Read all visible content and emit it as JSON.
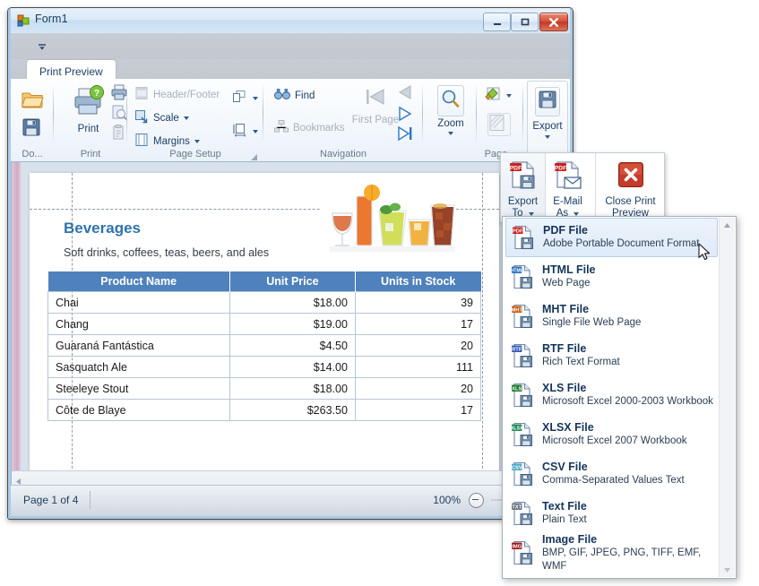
{
  "window": {
    "title": "Form1",
    "icon": "form-icon",
    "buttons": {
      "minimize": "minimize-button",
      "maximize": "maximize-button",
      "close": "close-button"
    }
  },
  "ribbon": {
    "tab": "Print Preview",
    "groups": [
      {
        "name": "Document",
        "label": "Do...",
        "items": [
          {
            "label": "",
            "icon": "open-folder-icon"
          },
          {
            "label": "",
            "icon": "save-floppy-icon"
          }
        ]
      },
      {
        "name": "Print",
        "label": "Print",
        "items": [
          {
            "label": "Print",
            "icon": "printer-icon"
          },
          {
            "label": "",
            "icon": "quick-print-icon"
          },
          {
            "label": "",
            "icon": "print-preview-icon"
          },
          {
            "label": "",
            "icon": "page-setup-icon"
          }
        ]
      },
      {
        "name": "Page Setup",
        "label": "Page Setup",
        "items": [
          {
            "label": "Header/Footer",
            "icon": "header-footer-icon",
            "disabled": true
          },
          {
            "label": "Scale",
            "icon": "scale-icon",
            "dropdown": true
          },
          {
            "label": "Margins",
            "icon": "margins-icon",
            "dropdown": true
          },
          {
            "label": "",
            "icon": "orientation-icon",
            "dropdown": true
          },
          {
            "label": "",
            "icon": "paper-size-icon",
            "dropdown": true
          }
        ]
      },
      {
        "name": "Navigation",
        "label": "Navigation",
        "items": [
          {
            "label": "Find",
            "icon": "binoculars-icon"
          },
          {
            "label": "Bookmarks",
            "icon": "bookmarks-icon",
            "disabled": true
          },
          {
            "label": "First Page",
            "icon": "first-page-icon",
            "disabled": true
          },
          {
            "label": "",
            "icon": "previous-page-icon",
            "disabled": true
          },
          {
            "label": "",
            "icon": "next-page-icon"
          },
          {
            "label": "",
            "icon": "last-page-icon"
          }
        ]
      },
      {
        "name": "Zoom",
        "label": "",
        "items": [
          {
            "label": "Zoom",
            "icon": "magnifier-icon",
            "dropdown": true
          }
        ]
      },
      {
        "name": "Page Background",
        "label": "Page...",
        "items": [
          {
            "label": "",
            "icon": "page-color-icon",
            "dropdown": true
          },
          {
            "label": "",
            "icon": "watermark-icon",
            "disabled": true
          }
        ]
      },
      {
        "name": "Export",
        "label": "",
        "items": [
          {
            "label": "Export",
            "icon": "export-icon",
            "dropdown": true
          }
        ]
      }
    ]
  },
  "report": {
    "title": "Beverages",
    "subtitle": "Soft drinks, coffees, teas, beers, and ales",
    "columns": [
      "Product Name",
      "Unit Price",
      "Units in Stock"
    ],
    "rows": [
      [
        "Chai",
        "$18.00",
        "39"
      ],
      [
        "Chang",
        "$19.00",
        "17"
      ],
      [
        "Guaraná Fantástica",
        "$4.50",
        "20"
      ],
      [
        "Sasquatch Ale",
        "$14.00",
        "111"
      ],
      [
        "Steeleye Stout",
        "$18.00",
        "20"
      ],
      [
        "Côte de Blaye",
        "$263.50",
        "17"
      ]
    ],
    "header_color": "#4f81bd",
    "title_color": "#2f72ad"
  },
  "statusbar": {
    "page_text": "Page 1 of 4",
    "zoom_text": "100%",
    "zoom_out_icon": "zoom-out-icon",
    "zoom_slider": "zoom-slider"
  },
  "floating_toolbar": {
    "items": [
      {
        "label_line1": "Export",
        "label_line2": "To",
        "icon": "export-to-icon",
        "dropdown": true,
        "active": true
      },
      {
        "label_line1": "E-Mail",
        "label_line2": "As",
        "icon": "email-as-icon",
        "dropdown": true
      },
      {
        "label_line1": "Close Print",
        "label_line2": "Preview",
        "icon": "close-preview-icon",
        "dropdown": false
      }
    ]
  },
  "export_menu": {
    "scroll_up_icon": "scroll-up-arrow-icon",
    "scroll_down_icon": "scroll-down-arrow-icon",
    "items": [
      {
        "title": "PDF File",
        "desc": "Adobe Portable Document Format",
        "badge": "PDF",
        "badge_color": "#c9211e",
        "selected": true
      },
      {
        "title": "HTML File",
        "desc": "Web Page",
        "badge": "HTML",
        "badge_color": "#2b6fc4",
        "selected": false
      },
      {
        "title": "MHT File",
        "desc": "Single File Web Page",
        "badge": "MHT",
        "badge_color": "#c75b13",
        "selected": false
      },
      {
        "title": "RTF File",
        "desc": "Rich Text Format",
        "badge": "RTF",
        "badge_color": "#3558b4",
        "selected": false
      },
      {
        "title": "XLS File",
        "desc": "Microsoft Excel 2000-2003 Workbook",
        "badge": "XLS",
        "badge_color": "#1d7a33",
        "selected": false
      },
      {
        "title": "XLSX File",
        "desc": "Microsoft Excel 2007 Workbook",
        "badge": "XLSX",
        "badge_color": "#1d8a56",
        "selected": false
      },
      {
        "title": "CSV File",
        "desc": "Comma-Separated Values Text",
        "badge": "CSV",
        "badge_color": "#4aa8c4",
        "selected": false
      },
      {
        "title": "Text File",
        "desc": "Plain Text",
        "badge": "TXT",
        "badge_color": "#6d7480",
        "selected": false
      },
      {
        "title": "Image File",
        "desc": "BMP, GIF, JPEG, PNG, TIFF, EMF, WMF",
        "badge": "IMG",
        "badge_color": "#9e1b1b",
        "selected": false
      }
    ]
  },
  "cursor": {
    "icon": "mouse-pointer-icon"
  }
}
